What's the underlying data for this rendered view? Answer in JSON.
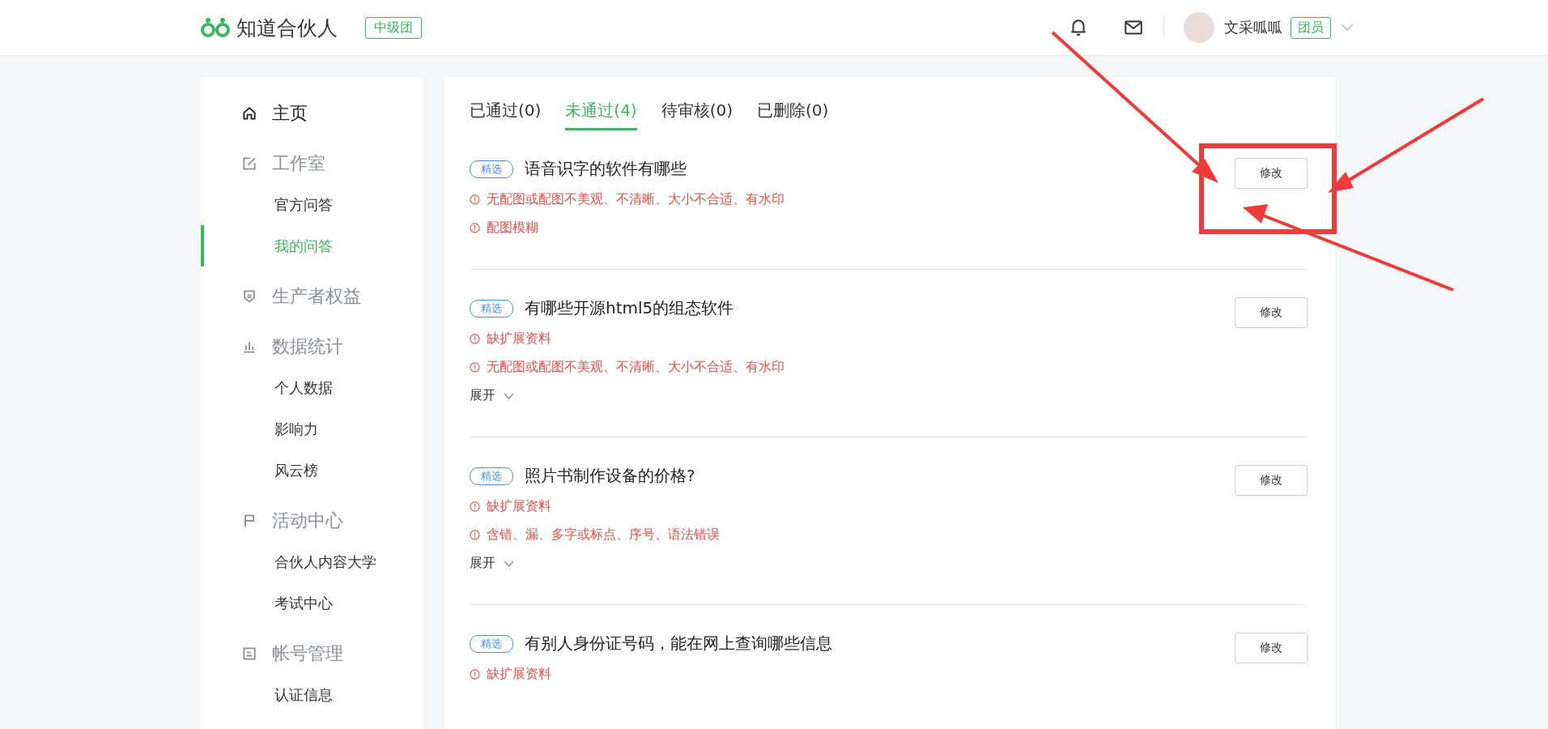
{
  "header": {
    "brand": "知道合伙人",
    "level_badge": "中级团",
    "user": {
      "name": "文采呱呱",
      "role": "团员"
    }
  },
  "sidebar": {
    "groups": [
      {
        "kind": "page",
        "label": "主页"
      },
      {
        "kind": "group",
        "label": "工作室",
        "children": [
          {
            "label": "官方问答",
            "selected": false
          },
          {
            "label": "我的问答",
            "selected": true
          }
        ]
      },
      {
        "kind": "group",
        "label": "生产者权益"
      },
      {
        "kind": "group",
        "label": "数据统计",
        "children": [
          {
            "label": "个人数据",
            "selected": false
          },
          {
            "label": "影响力",
            "selected": false
          },
          {
            "label": "风云榜",
            "selected": false
          }
        ]
      },
      {
        "kind": "group",
        "label": "活动中心",
        "children": [
          {
            "label": "合伙人内容大学",
            "selected": false
          },
          {
            "label": "考试中心",
            "selected": false
          }
        ]
      },
      {
        "kind": "group",
        "label": "帐号管理",
        "children": [
          {
            "label": "认证信息",
            "selected": false
          }
        ]
      }
    ]
  },
  "tabs": [
    {
      "label": "已通过(0)",
      "selected": false
    },
    {
      "label": "未通过(4)",
      "selected": true
    },
    {
      "label": "待审核(0)",
      "selected": false
    },
    {
      "label": "已删除(0)",
      "selected": false
    }
  ],
  "questions": [
    {
      "tag": "精选",
      "title": "语音识字的软件有哪些",
      "reasons": [
        "无配图或配图不美观、不清晰、大小不合适、有水印",
        "配图模糊"
      ],
      "button": "修改"
    },
    {
      "tag": "精选",
      "title": "有哪些开源html5的组态软件",
      "reasons": [
        "缺扩展资料",
        "无配图或配图不美观、不清晰、大小不合适、有水印"
      ],
      "expand": "展开",
      "button": "修改"
    },
    {
      "tag": "精选",
      "title": "照片书制作设备的价格?",
      "reasons": [
        "缺扩展资料",
        "含错、漏、多字或标点、序号、语法错误"
      ],
      "expand": "展开",
      "button": "修改"
    },
    {
      "tag": "精选",
      "title": "有别人身份证号码，能在网上查询哪些信息",
      "reasons": [
        "缺扩展资料"
      ],
      "button": "修改"
    }
  ]
}
